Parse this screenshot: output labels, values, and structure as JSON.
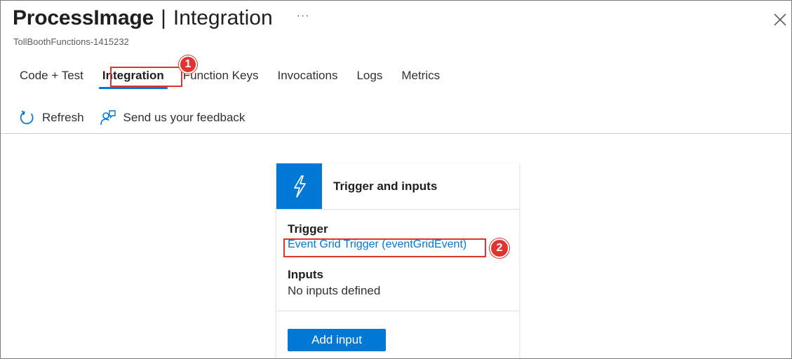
{
  "header": {
    "title_main": "ProcessImage",
    "title_separator": "|",
    "title_section": "Integration",
    "more_label": "···",
    "subtitle": "TollBoothFunctions-1415232",
    "close_icon": "close-icon"
  },
  "tabs": [
    {
      "label": "Code + Test",
      "active": false
    },
    {
      "label": "Integration",
      "active": true
    },
    {
      "label": "Function Keys",
      "active": false
    },
    {
      "label": "Invocations",
      "active": false
    },
    {
      "label": "Logs",
      "active": false
    },
    {
      "label": "Metrics",
      "active": false
    }
  ],
  "toolbar": {
    "refresh_label": "Refresh",
    "refresh_icon": "refresh-icon",
    "feedback_label": "Send us your feedback",
    "feedback_icon": "feedback-icon"
  },
  "card": {
    "title": "Trigger and inputs",
    "icon": "lightning-bolt-icon",
    "trigger_heading": "Trigger",
    "trigger_link": "Event Grid Trigger (eventGridEvent)",
    "inputs_heading": "Inputs",
    "inputs_empty": "No inputs defined",
    "add_input_label": "Add input"
  },
  "callouts": {
    "badge_1": "1",
    "badge_2": "2"
  },
  "colors": {
    "accent": "#0078d4",
    "callout": "#e0342f"
  }
}
